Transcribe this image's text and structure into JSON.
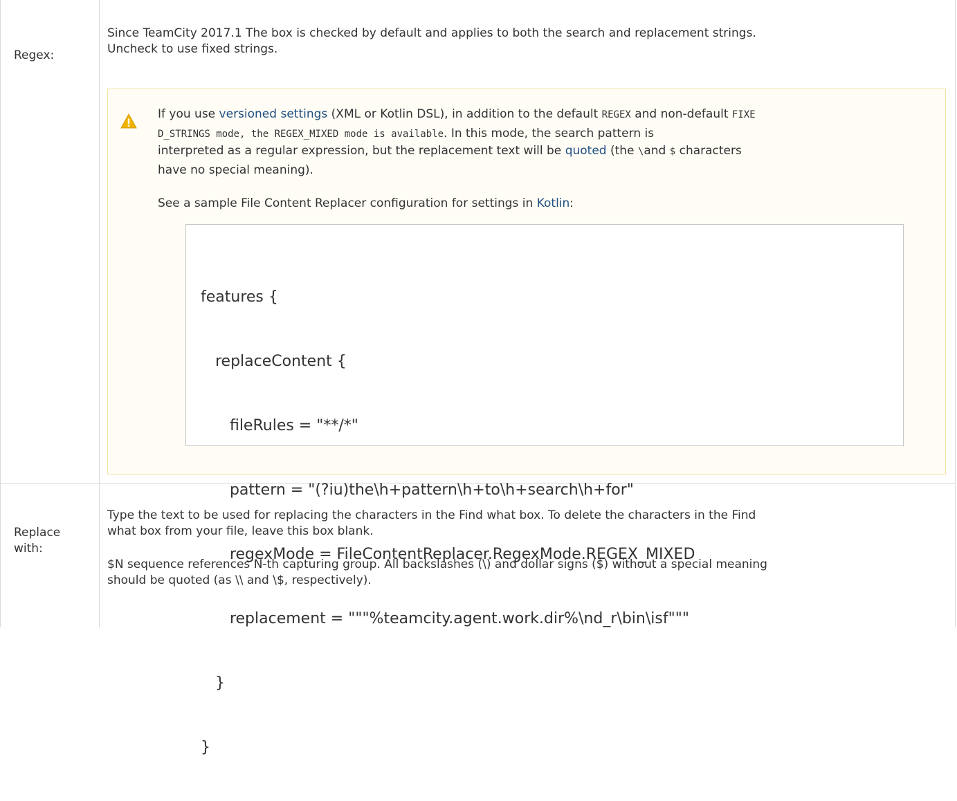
{
  "rows": [
    {
      "label": "Regex:",
      "description_line1": "Since TeamCity 2017.1 The box is checked by default and applies to both the search and replacement strings.",
      "description_line2": "Uncheck to use fixed strings.",
      "note": {
        "icon": "warning-icon",
        "line1_pre": "If you use ",
        "line1_link": "versioned settings",
        "line1_mid": " (XML or Kotlin DSL), in addition to the default ",
        "line1_code1": "REGEX",
        "line1_mid2": " and non-default ",
        "line1_code2": "FIXE",
        "line2_code": "D_STRINGS mode, the REGEX_MIXED mode is available",
        "line2_post": ". In this mode, the search pattern is",
        "line3_pre": "interpreted as a regular expression, but the replacement text will be ",
        "line3_link": "quoted",
        "line3_mid": " (the ",
        "line3_code1": "\\",
        "line3_mid2": "and ",
        "line3_code2": "$",
        "line3_post": " characters",
        "line4": "have no special meaning).",
        "sample_pre": "See a sample File Content Replacer configuration for settings in ",
        "sample_link": "Kotlin",
        "sample_post": ":",
        "code_lines": [
          "features {",
          "   replaceContent {",
          "      fileRules = \"**/*\"",
          "      pattern = \"(?iu)the\\h+pattern\\h+to\\h+search\\h+for\"",
          "      regexMode = FileContentReplacer.RegexMode.REGEX_MIXED",
          "      replacement = \"\"\"%teamcity.agent.work.dir%\\nd_r\\bin\\isf\"\"\"",
          "   }",
          "}"
        ]
      }
    },
    {
      "label_line1": "Replace",
      "label_line2": "with:",
      "para1_line1": "Type the text to be used for replacing the characters in the Find what box. To delete the characters in the Find",
      "para1_line2": "what box from your file, leave this box blank.",
      "para2_line1": "$N sequence references N-th capturing group. All backslashes (\\) and dollar signs ($) without a special meaning",
      "para2_line2": "should be quoted (as \\\\ and \\$, respectively)."
    }
  ],
  "colors": {
    "link": "#205081",
    "note_background": "#fffdf6",
    "note_border": "#f4e0a5",
    "warning_icon": "#f0b400",
    "text": "#333333",
    "table_border": "#d9d9d9"
  }
}
